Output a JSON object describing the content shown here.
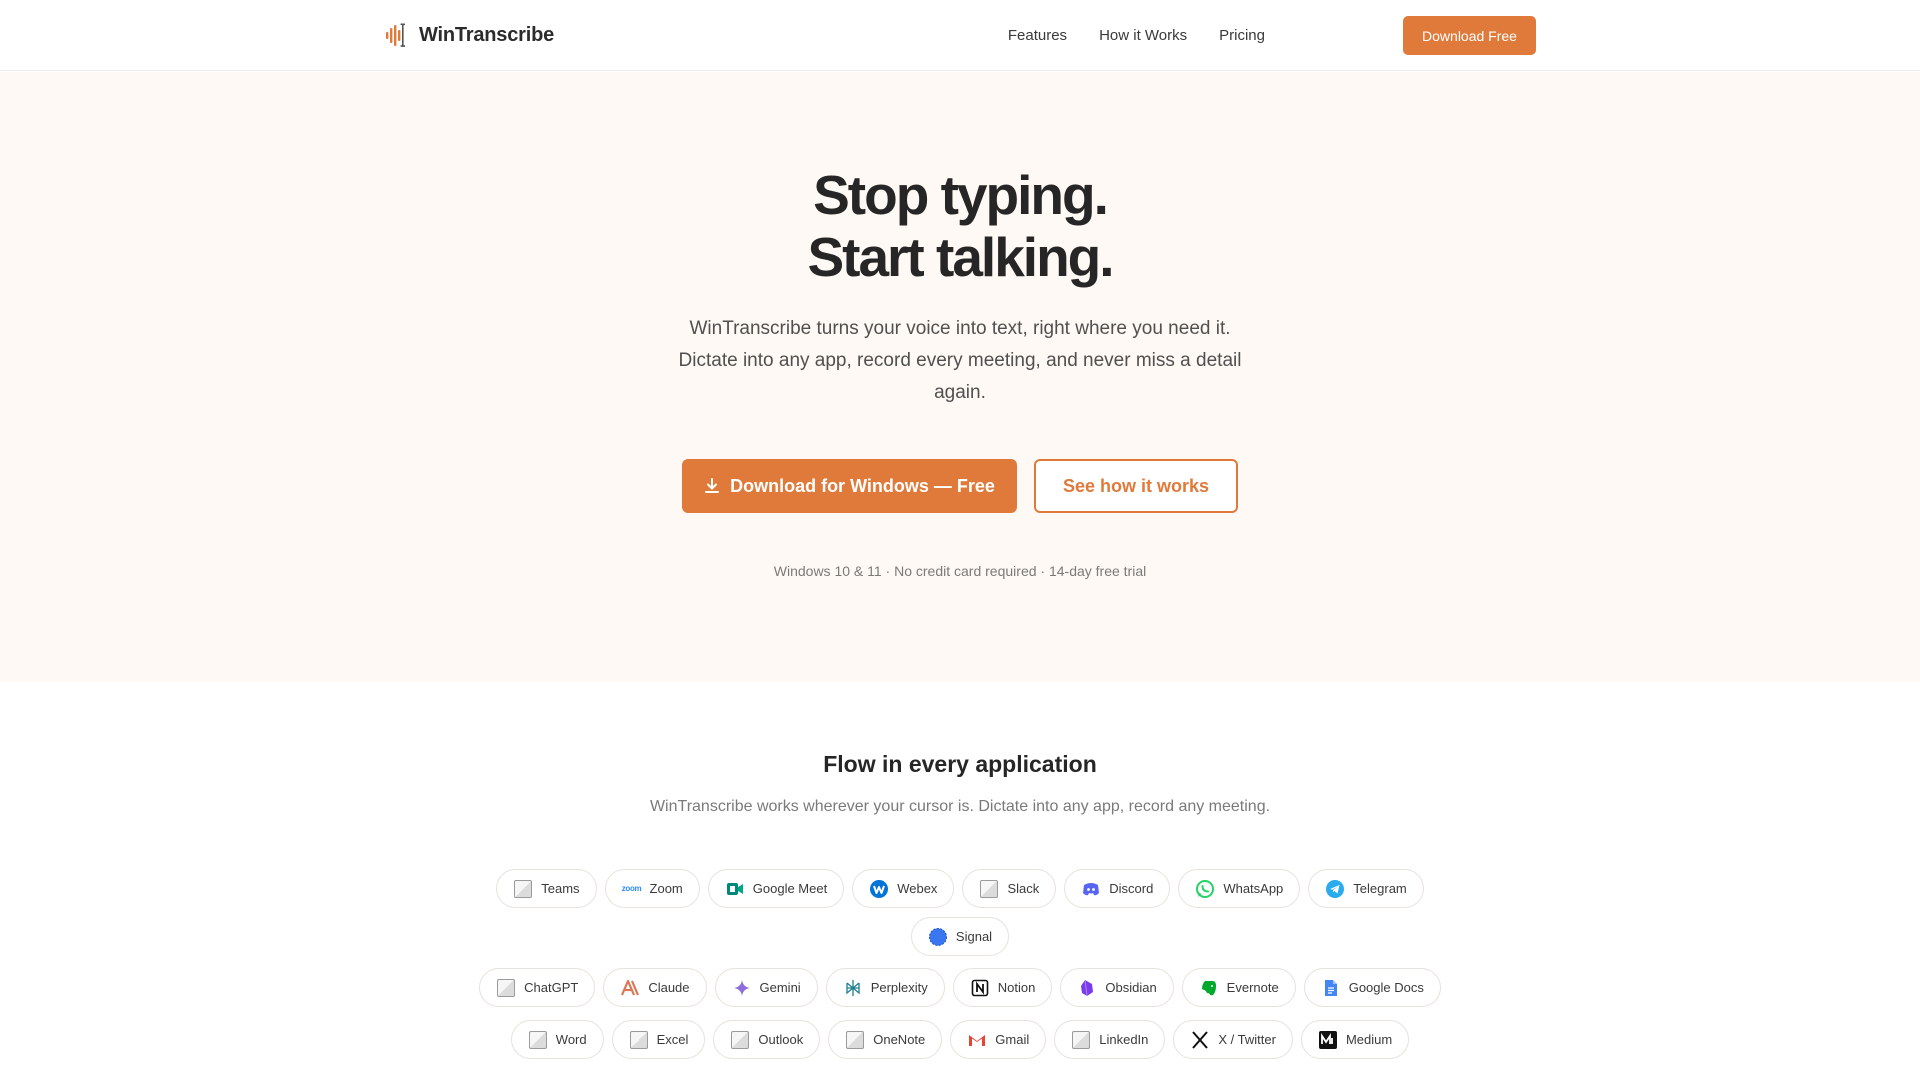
{
  "brand": {
    "name": "WinTranscribe",
    "accent": "#e07a3a"
  },
  "nav": {
    "links": [
      "Features",
      "How it Works",
      "Pricing"
    ],
    "cta": "Download Free"
  },
  "hero": {
    "title_line1": "Stop typing.",
    "title_line2": "Start talking.",
    "subtitle": "WinTranscribe turns your voice into text, right where you need it. Dictate into any app, record every meeting, and never miss a detail again.",
    "primary_button": "Download for Windows — Free",
    "secondary_button": "See how it works",
    "note": "Windows 10 & 11 · No credit card required · 14-day free trial"
  },
  "apps": {
    "title": "Flow in every application",
    "subtitle": "WinTranscribe works wherever your cursor is. Dictate into any app, record any meeting.",
    "zoom_icon_text": "zoom",
    "rows": [
      [
        {
          "label": "Teams",
          "icon": "broken-image-icon"
        },
        {
          "label": "Zoom",
          "icon": "zoom-icon"
        },
        {
          "label": "Google Meet",
          "icon": "google-meet-icon"
        },
        {
          "label": "Webex",
          "icon": "webex-icon"
        },
        {
          "label": "Slack",
          "icon": "broken-image-icon"
        },
        {
          "label": "Discord",
          "icon": "discord-icon"
        },
        {
          "label": "WhatsApp",
          "icon": "whatsapp-icon"
        },
        {
          "label": "Telegram",
          "icon": "telegram-icon"
        }
      ],
      [
        {
          "label": "Signal",
          "icon": "signal-icon"
        }
      ],
      [
        {
          "label": "ChatGPT",
          "icon": "broken-image-icon"
        },
        {
          "label": "Claude",
          "icon": "claude-icon"
        },
        {
          "label": "Gemini",
          "icon": "gemini-icon"
        },
        {
          "label": "Perplexity",
          "icon": "perplexity-icon"
        },
        {
          "label": "Notion",
          "icon": "notion-icon"
        },
        {
          "label": "Obsidian",
          "icon": "obsidian-icon"
        },
        {
          "label": "Evernote",
          "icon": "evernote-icon"
        },
        {
          "label": "Google Docs",
          "icon": "google-docs-icon"
        }
      ],
      [
        {
          "label": "Word",
          "icon": "broken-image-icon"
        },
        {
          "label": "Excel",
          "icon": "broken-image-icon"
        },
        {
          "label": "Outlook",
          "icon": "broken-image-icon"
        },
        {
          "label": "OneNote",
          "icon": "broken-image-icon"
        },
        {
          "label": "Gmail",
          "icon": "gmail-icon"
        },
        {
          "label": "LinkedIn",
          "icon": "broken-image-icon"
        },
        {
          "label": "X / Twitter",
          "icon": "x-twitter-icon"
        },
        {
          "label": "Medium",
          "icon": "medium-icon"
        }
      ]
    ]
  }
}
